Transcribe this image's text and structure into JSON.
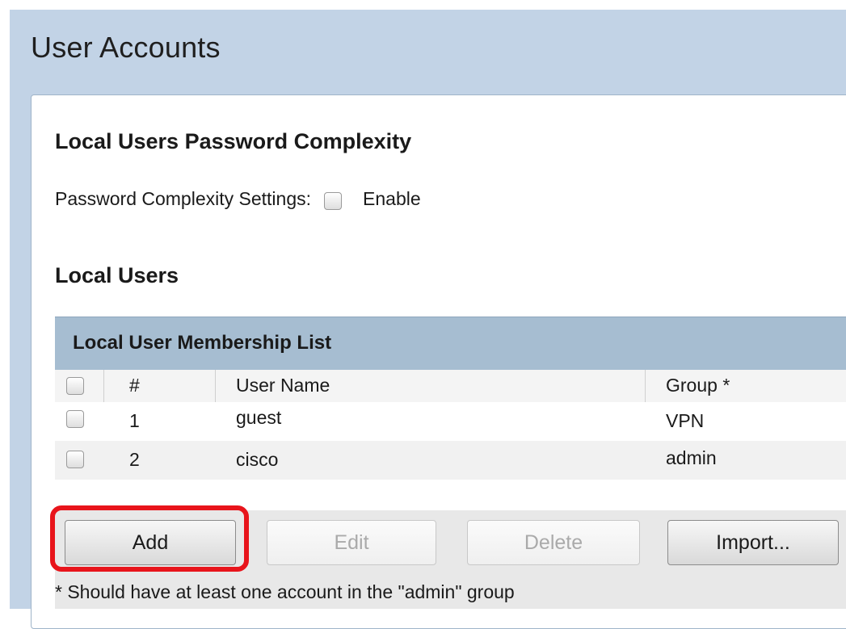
{
  "page": {
    "title": "User Accounts"
  },
  "password_complexity": {
    "heading": "Local Users Password Complexity",
    "label": "Password Complexity Settings:",
    "checkbox_label": "Enable",
    "enabled": false
  },
  "local_users": {
    "heading": "Local Users",
    "table": {
      "caption": "Local User Membership List",
      "columns": [
        "#",
        "User Name",
        "Group *"
      ],
      "rows": [
        {
          "num": "1",
          "user": "guest",
          "group": "VPN"
        },
        {
          "num": "2",
          "user": "cisco",
          "group": "admin"
        }
      ]
    },
    "buttons": {
      "add": "Add",
      "edit": "Edit",
      "delete": "Delete",
      "import": "Import..."
    },
    "footnote": "* Should have at least one account in the \"admin\" group"
  },
  "colors": {
    "page_background": "#c2d3e6",
    "table_caption": "#a6bdd1",
    "highlight": "#e8141b"
  }
}
